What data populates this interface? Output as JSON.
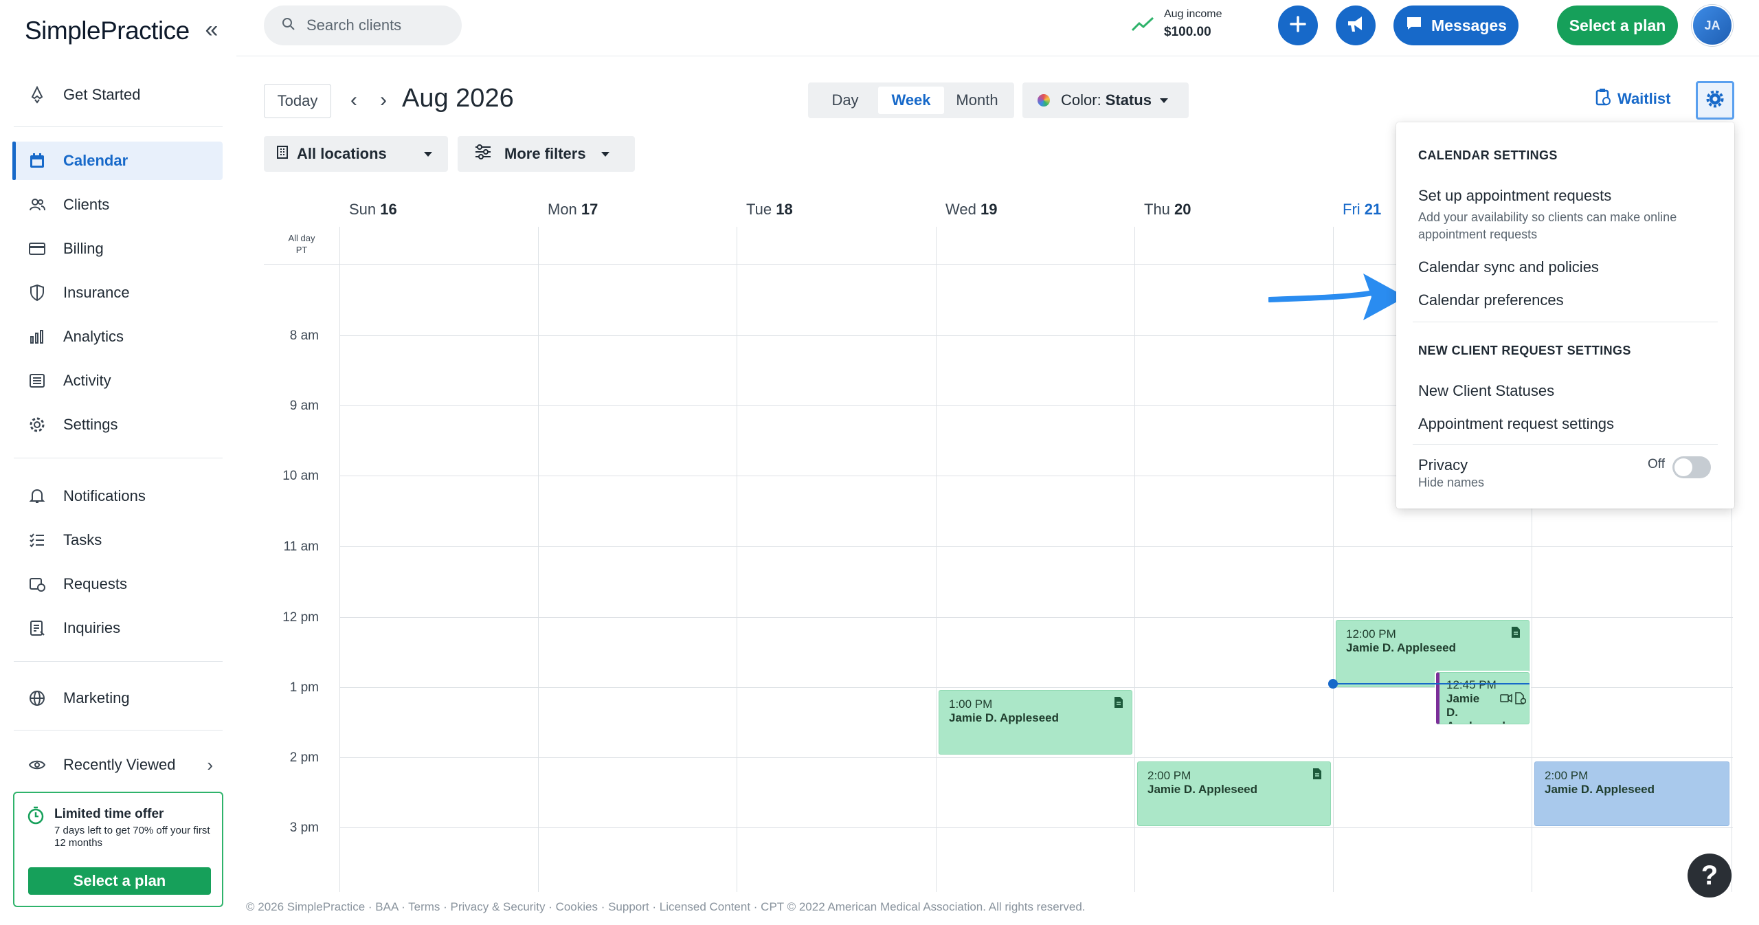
{
  "app": {
    "logo": "SimplePractice",
    "collapse_icon": "double-chevron-left-icon"
  },
  "sidebar": {
    "items": [
      {
        "label": "Get Started",
        "icon": "rocket-icon"
      },
      {
        "label": "Calendar",
        "icon": "calendar-icon",
        "active": true
      },
      {
        "label": "Clients",
        "icon": "clients-icon"
      },
      {
        "label": "Billing",
        "icon": "billing-card-icon"
      },
      {
        "label": "Insurance",
        "icon": "shield-icon"
      },
      {
        "label": "Analytics",
        "icon": "bar-chart-icon"
      },
      {
        "label": "Activity",
        "icon": "activity-list-icon"
      },
      {
        "label": "Settings",
        "icon": "gear-icon"
      },
      {
        "label": "Notifications",
        "icon": "bell-icon"
      },
      {
        "label": "Tasks",
        "icon": "checklist-icon"
      },
      {
        "label": "Requests",
        "icon": "calendar-clock-icon"
      },
      {
        "label": "Inquiries",
        "icon": "inquiry-form-icon"
      },
      {
        "label": "Marketing",
        "icon": "globe-icon"
      },
      {
        "label": "Recently Viewed",
        "icon": "eye-icon"
      }
    ],
    "offer": {
      "title": "Limited time offer",
      "description": "7 days left to get 70% off your first 12 months",
      "button": "Select a plan"
    }
  },
  "topbar": {
    "search_placeholder": "Search clients",
    "income_label": "Aug income",
    "income_value": "$100.00",
    "messages": "Messages",
    "select_plan": "Select a plan",
    "avatar_initials": "JA"
  },
  "toolbar": {
    "today": "Today",
    "month_title": "Aug 2026",
    "views": [
      "Day",
      "Week",
      "Month"
    ],
    "selected_view": "Week",
    "color_label": "Color:",
    "color_value": "Status",
    "locations": "All locations",
    "more_filters": "More filters",
    "waitlist": "Waitlist"
  },
  "calendar": {
    "days": [
      {
        "dow": "Sun",
        "date": "16"
      },
      {
        "dow": "Mon",
        "date": "17"
      },
      {
        "dow": "Tue",
        "date": "18"
      },
      {
        "dow": "Wed",
        "date": "19"
      },
      {
        "dow": "Thu",
        "date": "20"
      },
      {
        "dow": "Fri",
        "date": "21",
        "today": true
      }
    ],
    "allday_label": "All day",
    "timezone": "PT",
    "hours": [
      "8 am",
      "9 am",
      "10 am",
      "11 am",
      "12 pm",
      "1 pm",
      "2 pm",
      "3 pm"
    ],
    "appointments": [
      {
        "time": "12:00 PM",
        "client": "Jamie D. Appleseed",
        "day": "Fri",
        "color": "green"
      },
      {
        "time": "12:45 PM",
        "client": "Jamie D. Appleseed",
        "day": "Fri",
        "color": "green",
        "telehealth": true
      },
      {
        "time": "1:00 PM",
        "client": "Jamie D. Appleseed",
        "day": "Wed",
        "color": "green"
      },
      {
        "time": "2:00 PM",
        "client": "Jamie D. Appleseed",
        "day": "Thu",
        "color": "green"
      },
      {
        "time": "2:00 PM",
        "client": "Jamie D. Appleseed",
        "day": "Sat",
        "color": "blue"
      }
    ]
  },
  "settings_menu": {
    "calendar_section": "CALENDAR SETTINGS",
    "appt_requests": "Set up appointment requests",
    "appt_requests_desc": "Add your availability so clients can make online appointment requests",
    "sync_policies": "Calendar sync and policies",
    "preferences": "Calendar preferences",
    "client_section": "NEW CLIENT REQUEST SETTINGS",
    "client_statuses": "New Client Statuses",
    "appt_request_settings": "Appointment request settings",
    "privacy": "Privacy",
    "privacy_desc": "Hide names",
    "privacy_state": "Off"
  },
  "footer": "© 2026 SimplePractice · BAA · Terms · Privacy & Security · Cookies · Support · Licensed Content · CPT © 2022 American Medical Association. All rights reserved.",
  "help": "?",
  "colors": {
    "primary": "#1769c9",
    "green": "#16a05a",
    "appt_green": "#abe7c8",
    "appt_blue": "#a9c9ec"
  }
}
